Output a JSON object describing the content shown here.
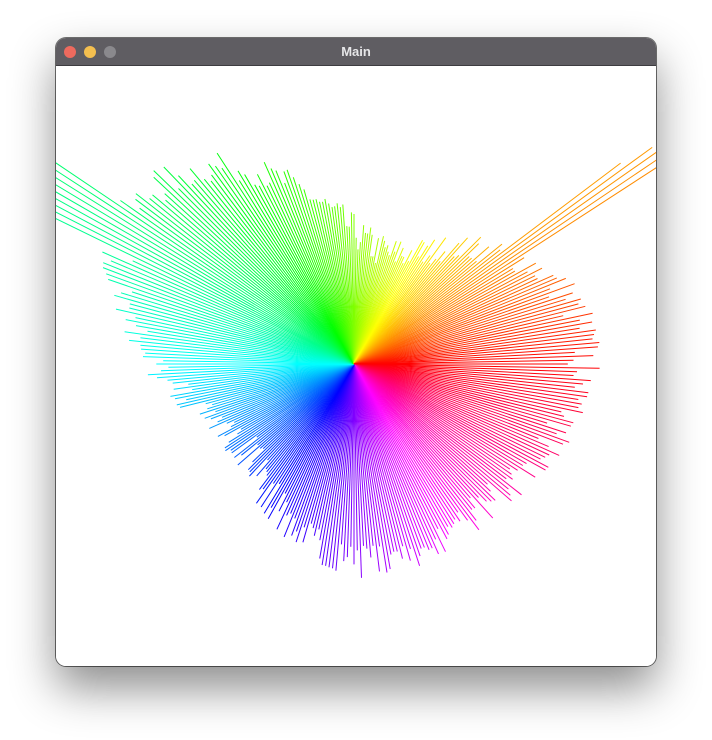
{
  "window": {
    "title": "Main",
    "buttons": [
      {
        "name": "close",
        "color": "#ed6a5e"
      },
      {
        "name": "minimize",
        "color": "#f4bf4f"
      },
      {
        "name": "zoom",
        "color": "#8a898d"
      }
    ]
  },
  "canvas": {
    "background": "#ffffff",
    "drawing": "radial-rainbow-lines",
    "line_count": 360
  }
}
